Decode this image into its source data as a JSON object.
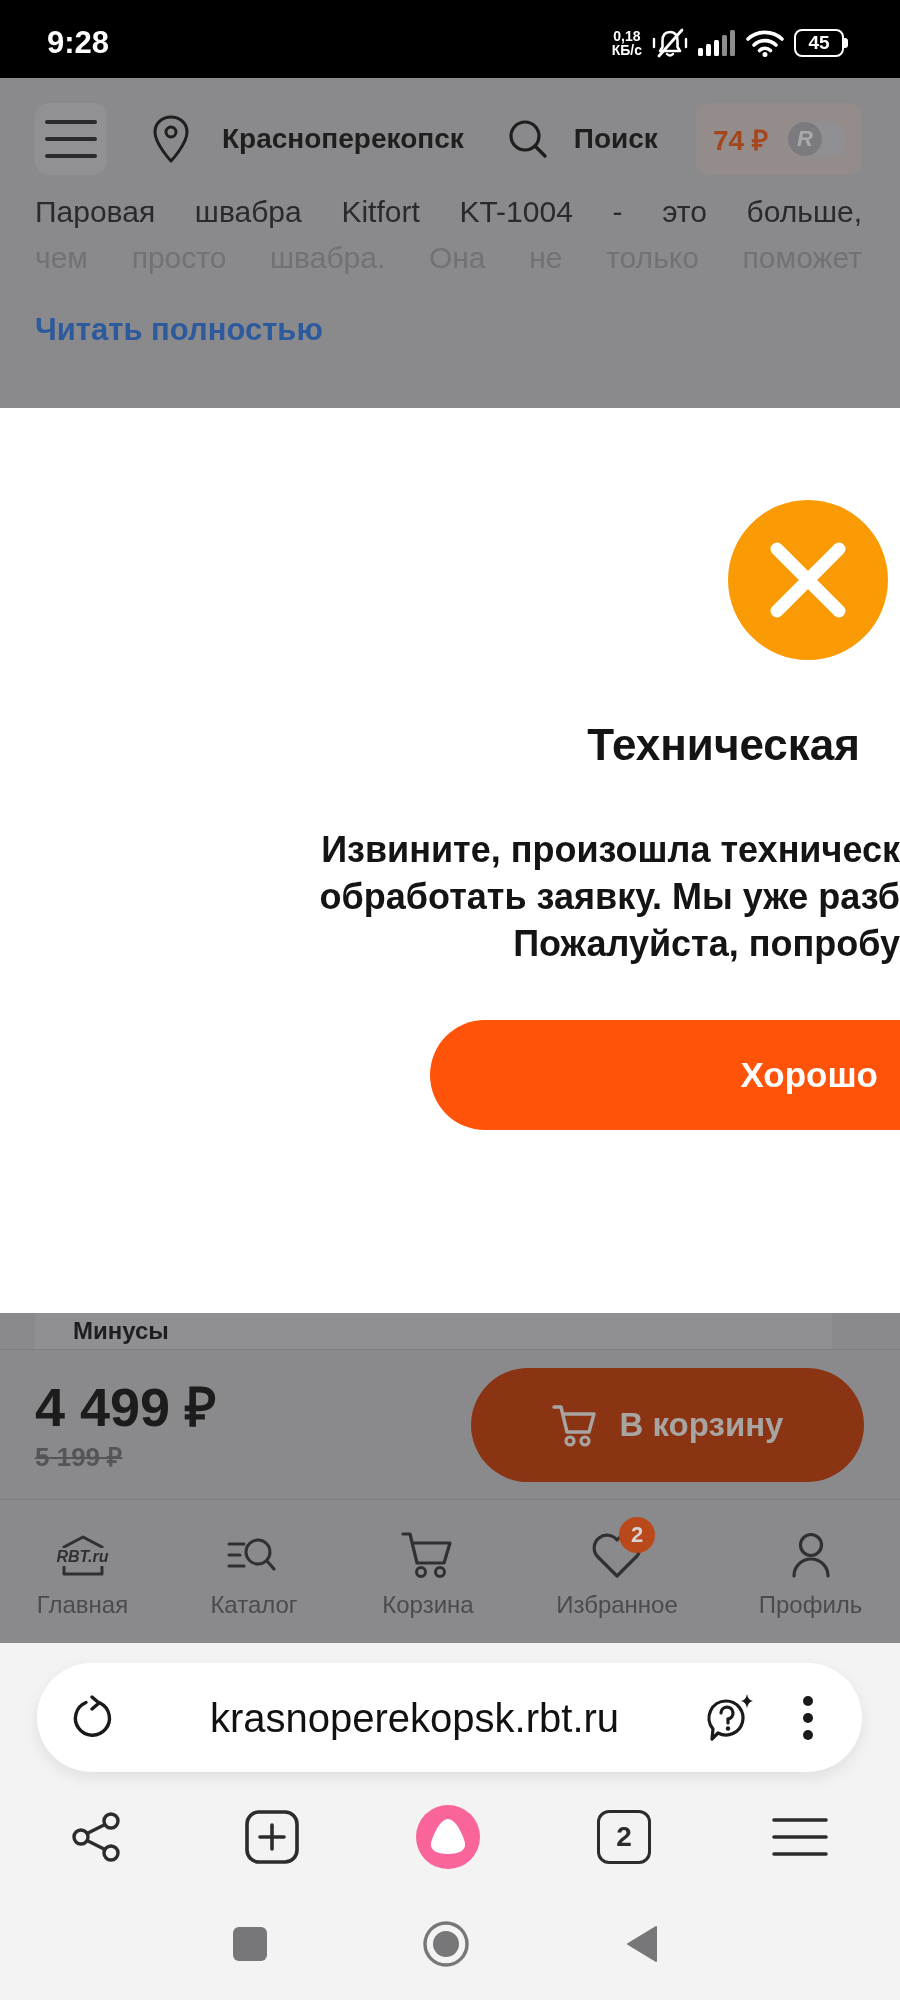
{
  "status_bar": {
    "time": "9:28",
    "net_speed": "0,18",
    "net_unit": "КБ/с",
    "battery": "45"
  },
  "header": {
    "city": "Красноперекопск",
    "search": "Поиск",
    "bonus": {
      "amount": "74 ₽",
      "knob_letter": "R",
      "on": false
    }
  },
  "description": {
    "lines": [
      "Паровая швабра Kitfort KT-1004 - это больше,",
      "чем просто швабра. Она не только поможет"
    ],
    "read_more": "Читать полностью"
  },
  "dialog": {
    "title": "Техническая",
    "message_lines": [
      "Извините, произошла техническ",
      "обработать заявку. Мы уже разб",
      "Пожалуйста, попробу"
    ],
    "button": "Хорошо"
  },
  "section_peek": {
    "title": "Минусы"
  },
  "buy_bar": {
    "price": "4 499 ₽",
    "old_price": "5 199 ₽",
    "button": "В корзину"
  },
  "bottom_nav": [
    {
      "kind": "home",
      "logo": "RBT.ru",
      "label": "Главная"
    },
    {
      "kind": "catalog",
      "label": "Каталог"
    },
    {
      "kind": "cart",
      "label": "Корзина"
    },
    {
      "kind": "favorites",
      "label": "Избранное",
      "badge": "2"
    },
    {
      "kind": "profile",
      "label": "Профиль"
    }
  ],
  "browser": {
    "url": "krasnoperekopsk.rbt.ru",
    "tab_count": "2"
  }
}
